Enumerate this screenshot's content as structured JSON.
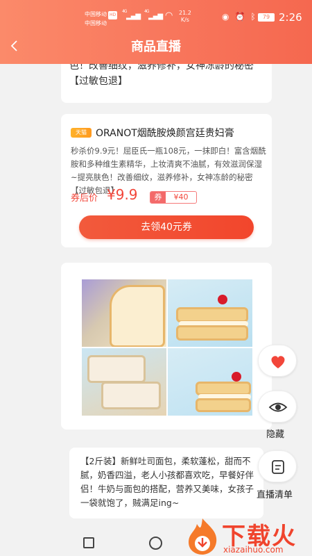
{
  "status_bar": {
    "carrier1": "中国移动",
    "carrier_badge": "HD",
    "carrier2": "中国移动",
    "net1": "4G",
    "net2": "4G",
    "speed_value": "21.2",
    "speed_unit": "K/s",
    "battery": "79",
    "time": "2:26"
  },
  "header": {
    "title": "商品直播",
    "back_icon": "chevron-left-icon"
  },
  "cards": {
    "prev_desc": "华，上妆清爽不油腻，有效滋润保湿提亮肤色！改善细纹，滋养修补，女神冻龄的秘密【过敏包退】",
    "product": {
      "badge": "天猫",
      "title": "ORANOT烟酰胺焕颜宫廷贵妇膏",
      "desc": "秒杀价9.9元！屈臣氏一瓶108元，一抹即白！富含烟酰胺和多种维生素精华，上妆清爽不油腻，有效滋润保湿~提亮肤色！改善细纹，滋养修补，女神冻龄的秘密【过敏包退】",
      "price_label": "券后价",
      "price": "¥9.9",
      "coupon_label": "券",
      "coupon_value": "¥40",
      "button": "去领40元券"
    },
    "next_desc": "【2斤装】新鲜吐司面包，柔软蓬松，甜而不腻，奶香四溢，老人小孩都喜欢吃，早餐好伴侣！牛奶与面包的搭配，营养又美味，女孩子一袋就饱了，贼满足ing~"
  },
  "float_buttons": {
    "like_icon": "heart-icon",
    "hide_label": "隐藏",
    "hide_icon": "eye-icon",
    "list_label": "直播清单",
    "list_icon": "list-icon"
  },
  "watermark": {
    "text": "下载火",
    "url": "xiazaihuo.com"
  },
  "colors": {
    "header_gradient_start": "#fb8a6a",
    "header_gradient_end": "#f5684f",
    "accent_red": "#f2463a",
    "badge_orange": "#ff9a1f"
  }
}
